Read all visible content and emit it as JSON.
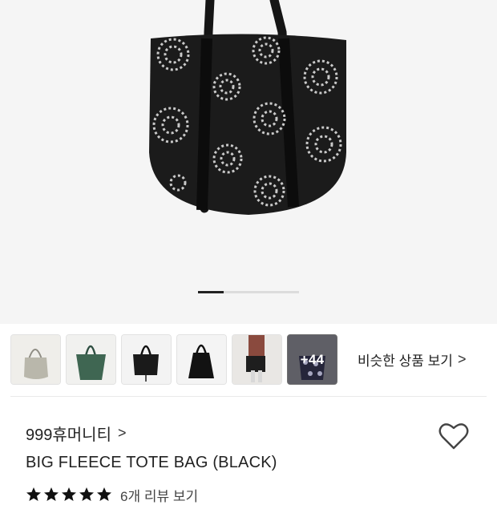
{
  "carousel": {
    "current_page": 1,
    "image_label": "black fleece tote bag with white flower pattern"
  },
  "thumbnails": [
    {
      "name": "thumb-beige-tote"
    },
    {
      "name": "thumb-green-tote"
    },
    {
      "name": "thumb-black-tote-stand"
    },
    {
      "name": "thumb-black-tote-flat"
    },
    {
      "name": "thumb-model-with-tote"
    },
    {
      "name": "thumb-more",
      "more_label": "+44"
    }
  ],
  "similar_products": {
    "label": "비슷한 상품 보기",
    "chevron": ">"
  },
  "product": {
    "brand": "999휴머니티",
    "brand_chevron": ">",
    "title": "BIG FLEECE TOTE BAG (BLACK)",
    "rating_stars": 5,
    "review_label": "6개 리뷰 보기"
  },
  "colors": {
    "bag": "#1b1b1b",
    "flower": "#c9c9c9",
    "star": "#111111"
  }
}
